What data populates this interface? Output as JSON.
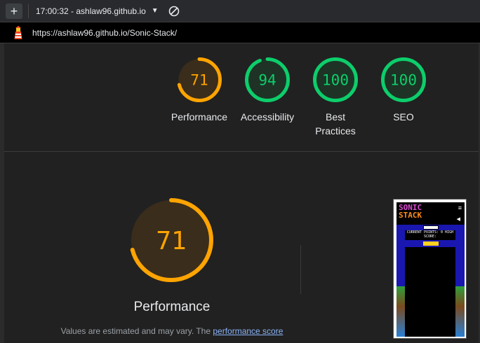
{
  "toolbar": {
    "add_label": "+",
    "title": "17:00:32 - ashlaw96.github.io",
    "caret": "▼"
  },
  "urlbar": {
    "url": "https://ashlaw96.github.io/Sonic-Stack/"
  },
  "scores": [
    {
      "value": "71",
      "label": "Performance",
      "fraction": 0.71,
      "color": "#ffa400",
      "bg": "#3a2d1b"
    },
    {
      "value": "94",
      "label": "Accessibility",
      "fraction": 0.94,
      "color": "#0cce6b",
      "bg": "#1e3325"
    },
    {
      "value": "100",
      "label": "Best Practices",
      "fraction": 1.0,
      "color": "#0cce6b",
      "bg": "#1e3325"
    },
    {
      "value": "100",
      "label": "SEO",
      "fraction": 1.0,
      "color": "#0cce6b",
      "bg": "#1e3325"
    }
  ],
  "detail": {
    "value": "71",
    "label": "Performance",
    "fraction": 0.71,
    "color": "#ffa400",
    "bg": "#3a2d1b",
    "note_prefix": "Values are estimated and may vary. The ",
    "note_link": "performance score"
  },
  "thumbnail": {
    "title_line1": "SONIC",
    "title_line2": "STACK",
    "menu_icon": "≡",
    "speaker_icon": "◀",
    "score_text": "CURRENT POINTS: 0 HIGH SCORE:"
  }
}
